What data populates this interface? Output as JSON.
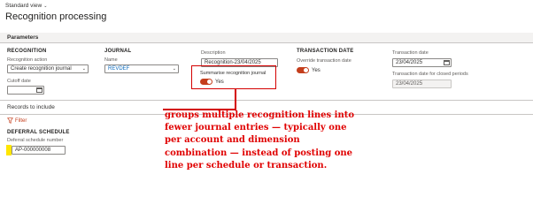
{
  "header": {
    "standard_view": "Standard view",
    "title": "Recognition processing"
  },
  "parameters": {
    "section_label": "Parameters",
    "recognition": {
      "heading": "RECOGNITION",
      "action_label": "Recognition action",
      "action_value": "Create recognition journal",
      "cutoff_label": "Cutoff date",
      "cutoff_value": ""
    },
    "journal": {
      "heading": "JOURNAL",
      "name_label": "Name",
      "name_value": "REVDEF"
    },
    "description": {
      "label": "Description",
      "value": "Recognition-23/04/2025"
    },
    "summarise": {
      "label": "Summarise recognition journal",
      "value": "Yes"
    },
    "transaction_date": {
      "heading": "TRANSACTION DATE",
      "override_label": "Override transaction date",
      "override_value": "Yes",
      "date_label": "Transaction date",
      "date_value": "23/04/2025",
      "closed_label": "Transaction date for closed periods",
      "closed_value": "23/04/2025"
    }
  },
  "records": {
    "section_label": "Records to include",
    "filter_label": "Filter",
    "deferral": {
      "heading": "DEFERRAL SCHEDULE",
      "number_label": "Deferral schedule number",
      "number_value": "AP-000000008"
    }
  },
  "annotation": {
    "lines": [
      "groups multiple recognition lines into",
      "fewer journal entries — typically one",
      "per account and dimension",
      "combination — instead of posting one",
      "line per schedule or transaction."
    ]
  },
  "colors": {
    "accent": "#c43e1c",
    "annotation": "#e00000",
    "highlight": "#ffe600",
    "link": "#0f6cbd"
  }
}
